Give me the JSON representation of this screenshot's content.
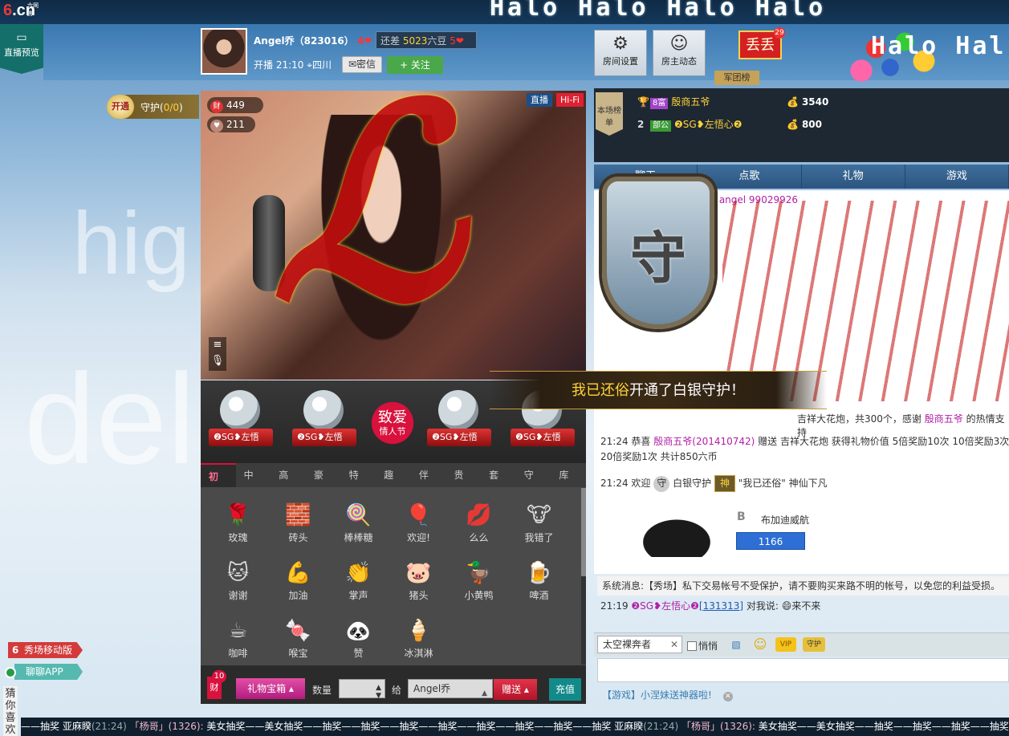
{
  "top": {
    "logo_mark": "6",
    "logo_suffix": ".cn",
    "logo_small": "六间房",
    "marquee": "Halo Halo Halo Halo",
    "marquee2": "Halo Hal",
    "preview_label": "直播预览"
  },
  "host": {
    "name": "Angel乔（823016）",
    "hearts": "4❤",
    "gap_prefix": "还差",
    "gap_value": "5023",
    "gap_suffix": "六豆",
    "gap_hearts": "5❤",
    "onair": "开播 21:10",
    "location": "四川",
    "msg_label": "密信",
    "follow_label": "+ 关注"
  },
  "header_buttons": {
    "room_settings": "房间设置",
    "host_feed": "房主动态"
  },
  "fan": {
    "flag": "丢丢",
    "badge_num": "29",
    "label": "军团榜"
  },
  "guard": {
    "open": "开通",
    "label": "守护(",
    "count": "0/0",
    "close": ")"
  },
  "video": {
    "wealth": "449",
    "wealth_icon": "财",
    "likes": "211",
    "live_tag": "直播",
    "hifi_tag": "Hi-Fi"
  },
  "rank": {
    "badge": "本场榜单",
    "rows": [
      {
        "no": "",
        "level": "8富",
        "name": "殷商五爷",
        "coins": "3540"
      },
      {
        "no": "2",
        "level": "部公",
        "name": "❷SG❥左悟心❷",
        "coins": "800"
      }
    ]
  },
  "chat_tabs": [
    "聊天",
    "点歌",
    "礼物",
    "游戏"
  ],
  "chat": {
    "announce": "点击这里】优惠多多。群号 angel 99029926",
    "sys1_pre": "吉祥大花炮，共300个，感谢",
    "sys1_name": "殷商五爷",
    "sys1_post": "的热情支持",
    "l1_time": "21:24",
    "l1_text": "恭喜",
    "l1_name": "殷商五爷(201410742)",
    "l1_rest": "赠送 吉祥大花炮 获得礼物价值 5倍奖励10次 10倍奖励3次 20倍奖励1次 共计850六币",
    "l2_time": "21:24",
    "l2_pre": "欢迎",
    "l2_guard": "白银守护",
    "l2_badge": "神",
    "l2_rest": "\"我已还俗\" 神仙下凡",
    "car_logo": "B",
    "car_name": "布加迪威航",
    "car_num": "1166",
    "sysmsg": "系统消息:【秀场】私下交易帐号不受保护，请不要购买来路不明的帐号，以免您的利益受损。",
    "say_time": "21:19",
    "say_name": "❷SG❥左悟心❷",
    "say_id": "[131313]",
    "say_mid": "对我说:",
    "say_text": "来不来"
  },
  "input": {
    "target": "太空裸奔者",
    "quiet": "悄悄",
    "vip": "VIP",
    "guard": "守护"
  },
  "ad": {
    "text": "【游戏】小涅妹送神器啦!"
  },
  "shelf": {
    "globes": [
      "❷SG❥左悟",
      "❷SG❥左悟",
      "❷SG❥左悟",
      "❷SG❥左悟"
    ],
    "love_big": "致爱",
    "love_small": "情人节"
  },
  "banner": {
    "name": "我已还俗",
    "rest": "开通了白银守护！"
  },
  "shield_char": "守",
  "firework_char": "ℒ",
  "gift_tabs": [
    "初级",
    "中级",
    "高级",
    "豪华",
    "特殊",
    "趣味",
    "伴舞",
    "贵族",
    "套礼",
    "守护",
    "库存"
  ],
  "gifts": [
    {
      "name": "玫瑰",
      "icon": "🌹"
    },
    {
      "name": "砖头",
      "icon": "🧱"
    },
    {
      "name": "棒棒糖",
      "icon": "🍭"
    },
    {
      "name": "欢迎!",
      "icon": "🎈"
    },
    {
      "name": "么么",
      "icon": "💋"
    },
    {
      "name": "我错了",
      "icon": "🐮"
    },
    {
      "name": "谢谢",
      "icon": "🐱"
    },
    {
      "name": "加油",
      "icon": "💪"
    },
    {
      "name": "掌声",
      "icon": "👏"
    },
    {
      "name": "猪头",
      "icon": "🐷"
    },
    {
      "name": "小黄鸭",
      "icon": "🦆"
    },
    {
      "name": "啤酒",
      "icon": "🍺"
    },
    {
      "name": "咖啡",
      "icon": "☕"
    },
    {
      "name": "喉宝",
      "icon": "🍬"
    },
    {
      "name": "赞",
      "icon": "🐼"
    },
    {
      "name": "冰淇淋",
      "icon": "🍦"
    }
  ],
  "giftbar": {
    "wealth": "财",
    "wealth_num": "10",
    "treasure": "礼物宝箱",
    "qty_label": "数量",
    "to_label": "给",
    "recipient": "Angel乔",
    "send": "赠送",
    "recharge": "充值"
  },
  "side": {
    "mobile": "秀场移动版",
    "mobile_mark": "6",
    "chat_app": "聊聊APP",
    "guess": "猜你喜欢"
  },
  "ticker": [
    {
      "cls": "",
      "text": "——抽奖"
    },
    {
      "cls": "",
      "text": "  亚麻睽"
    },
    {
      "cls": "tm",
      "text": "(21:24)"
    },
    {
      "cls": "u",
      "text": "   「杨哥」(1326): "
    },
    {
      "cls": "",
      "text": "美女抽奖——美女抽奖——抽奖——抽奖——抽奖——抽奖——抽奖——抽奖——抽奖——抽奖"
    },
    {
      "cls": "",
      "text": "  亚麻睽"
    },
    {
      "cls": "tm",
      "text": "(21:24)"
    },
    {
      "cls": "u",
      "text": "   「杨哥」(1326): "
    },
    {
      "cls": "",
      "text": "美女抽奖——美女抽奖——抽奖——抽奖——抽奖——抽奖"
    }
  ],
  "bg": {
    "word1": "hig",
    "word2": "del"
  }
}
